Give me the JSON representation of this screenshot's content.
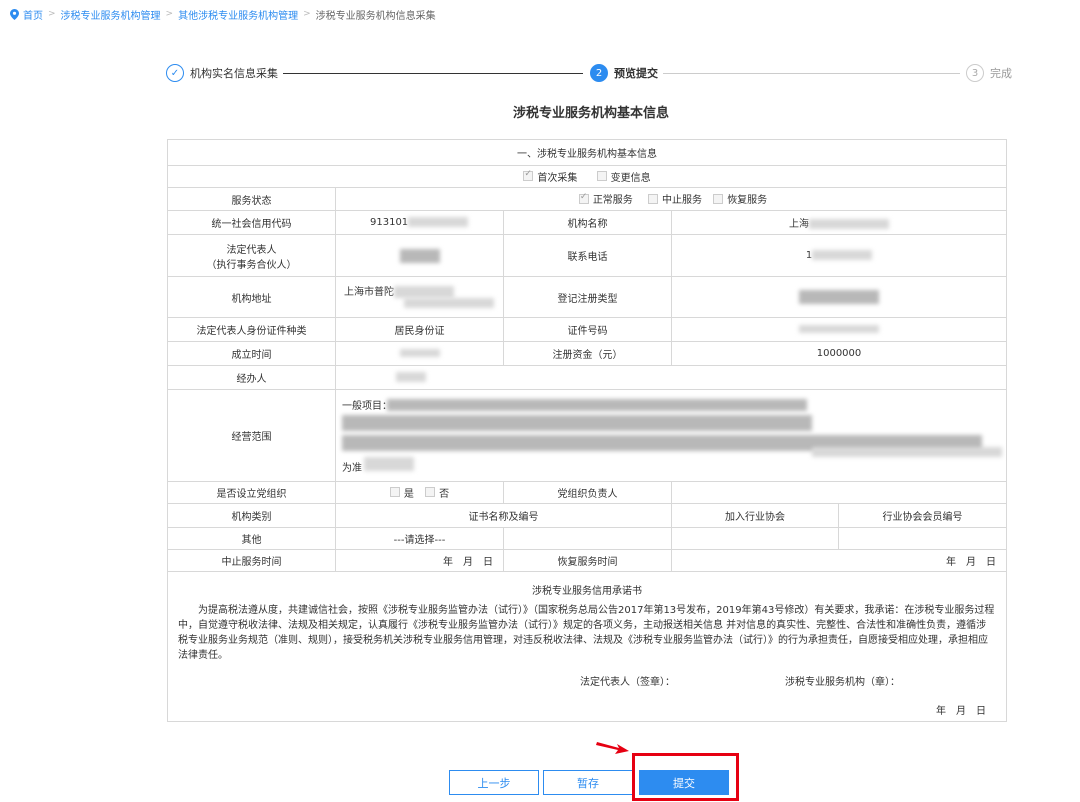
{
  "breadcrumb": [
    "首页",
    "涉税专业服务机构管理",
    "其他涉税专业服务机构管理",
    "涉税专业服务机构信息采集"
  ],
  "steps": [
    {
      "label": "机构实名信息采集",
      "state": "done",
      "mark": "✓"
    },
    {
      "label": "预览提交",
      "state": "active",
      "mark": "2"
    },
    {
      "label": "完成",
      "state": "todo",
      "mark": "3"
    }
  ],
  "page_title": "涉税专业服务机构基本信息",
  "section_title": "一、涉税专业服务机构基本信息",
  "collect_type": {
    "first": "首次采集",
    "change": "变更信息"
  },
  "labels": {
    "service_status": "服务状态",
    "credit_code": "统一社会信用代码",
    "org_name": "机构名称",
    "legal_rep": "法定代表人",
    "legal_rep_sub": "（执行事务合伙人）",
    "phone": "联系电话",
    "address": "机构地址",
    "reg_type": "登记注册类型",
    "id_type": "法定代表人身份证件种类",
    "id_number": "证件号码",
    "established": "成立时间",
    "capital": "注册资金（元）",
    "handler": "经办人",
    "scope": "经营范围",
    "party_org": "是否设立党组织",
    "party_leader": "党组织负责人",
    "org_category": "机构类别",
    "cert": "证书名称及编号",
    "industry_assoc": "加入行业协会",
    "assoc_member_no": "行业协会会员编号",
    "suspend_time": "中止服务时间",
    "resume_time": "恢复服务时间"
  },
  "service_status_opts": [
    "正常服务",
    "中止服务",
    "恢复服务"
  ],
  "values": {
    "credit_code": "913101",
    "org_name": "上海",
    "phone": "1",
    "address": "上海市普陀",
    "id_type": "居民身份证",
    "capital": "1000000",
    "scope_prefix": "一般项目：",
    "scope_tail": "为准",
    "org_category": "其他",
    "cert_select": "---请选择---"
  },
  "yes_no": [
    "是",
    "否"
  ],
  "date_ymd": "年　月　日",
  "promise": {
    "title": "涉税专业服务信用承诺书",
    "body": "为提高税法遵从度，共建诚信社会，按照《涉税专业服务监管办法（试行）》（国家税务总局公告2017年第13号发布，2019年第43号修改）有关要求，我承诺：在涉税专业服务过程中，自觉遵守税收法律、法规及相关规定，认真履行《涉税专业服务监管办法（试行）》规定的各项义务，主动报送相关信息 并对信息的真实性、完整性、合法性和准确性负责，遵循涉税专业服务业务规范（准则、规则），接受税务机关涉税专业服务信用管理，对违反税收法律、法规及《涉税专业服务监管办法（试行）》的行为承担责任，自愿接受相应处理，承担相应法律责任。",
    "sign_legal": "法定代表人（签章）：",
    "sign_org": "涉税专业服务机构（章）：",
    "date": "年　月　日"
  },
  "buttons": {
    "prev": "上一步",
    "save": "暂存",
    "submit": "提交"
  },
  "colors": {
    "accent": "#2d8cf0",
    "highlight": "#e60012"
  }
}
